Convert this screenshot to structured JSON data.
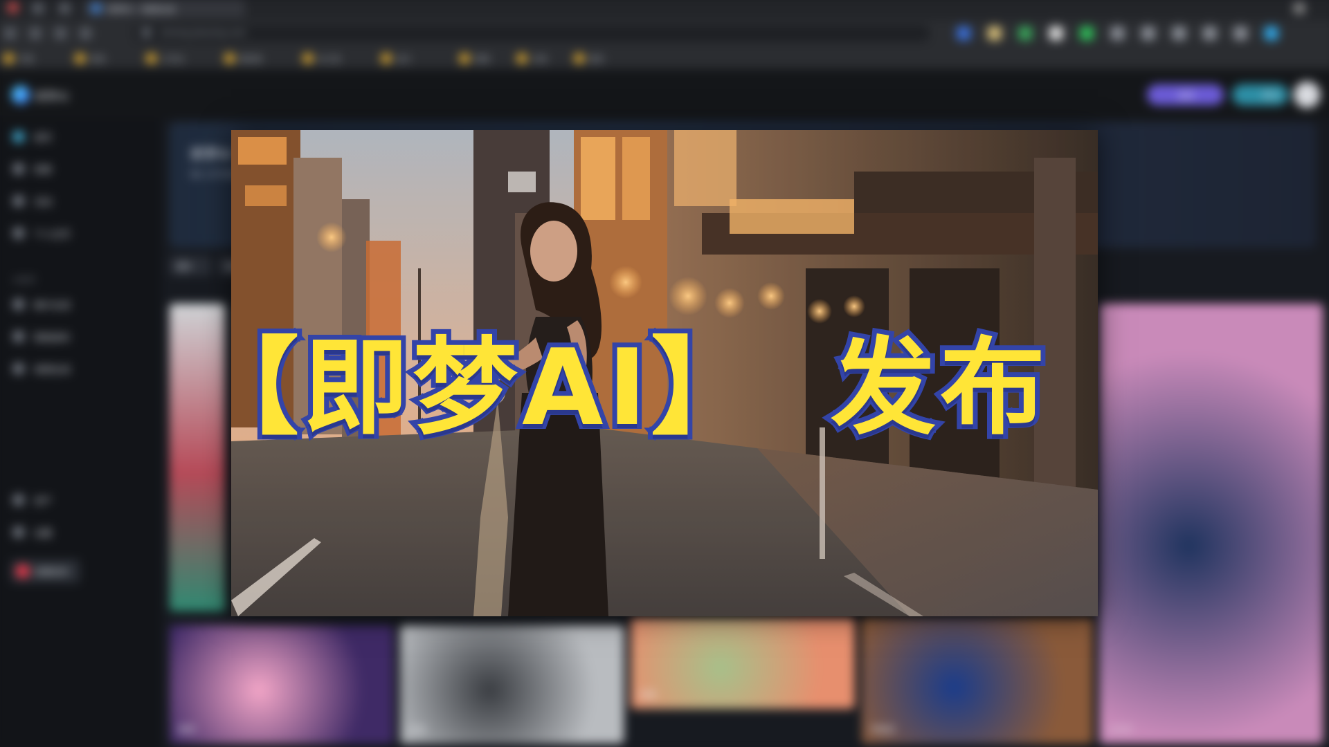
{
  "browser": {
    "tabs": [
      {
        "label": "即梦AI - 视频生成"
      }
    ],
    "address": "jimeng.jianying.com",
    "bookmarks": [
      {
        "label": "书签"
      },
      {
        "label": "常用"
      },
      {
        "label": "工作台"
      },
      {
        "label": "素材库"
      },
      {
        "label": "AI工具"
      },
      {
        "label": "设计"
      },
      {
        "label": "视频"
      },
      {
        "label": "文档"
      },
      {
        "label": "更多"
      }
    ],
    "extension_colors": [
      "#3a6fd8",
      "#d9c07a",
      "#39a55a",
      "#e0e0e0",
      "#2fbf59",
      "#8a8e96",
      "#8a8e96",
      "#8a8e96",
      "#8a8e96",
      "#8a8e96",
      "#31a7e6"
    ]
  },
  "site": {
    "brand": "即梦AI",
    "header_buttons": [
      {
        "label": "会员",
        "color": "#6b5bd6"
      },
      {
        "label": "积分",
        "color": "#2d8fa6"
      }
    ],
    "sidebar": {
      "items": [
        {
          "label": "首页"
        },
        {
          "label": "探索"
        },
        {
          "label": "活动"
        },
        {
          "label": "个人主页"
        }
      ],
      "section": "AI创作",
      "create_items": [
        {
          "label": "图片生成"
        },
        {
          "label": "智能画布"
        },
        {
          "label": "视频生成"
        }
      ],
      "badge": "故事创作",
      "bottom_items": [
        {
          "label": "资产"
        },
        {
          "label": "设置"
        }
      ]
    },
    "hero": {
      "title": "即梦AI 视频生成",
      "subtitle": "输入文字或图片，生成精彩视频"
    },
    "filters": [
      {
        "label": "图片"
      },
      {
        "label": "视频"
      }
    ],
    "gallery": [
      {
        "label": "星球",
        "colors": [
          "#f3a6c7",
          "#3f2a66"
        ]
      },
      {
        "label": "花海",
        "colors": [
          "#3a3d42",
          "#b9bcc0"
        ]
      },
      {
        "label": "田园",
        "colors": [
          "#a7c08a",
          "#e78f6e"
        ]
      },
      {
        "label": "宇航员",
        "colors": [
          "#1b3c8a",
          "#8a5a3a"
        ]
      },
      {
        "label": "小王子",
        "colors": [
          "#20345f",
          "#c98ab9"
        ]
      }
    ]
  },
  "overlay": {
    "part1": "【即梦AI】",
    "part2": "发布",
    "text_color": "#ffe537",
    "outline_color": "#3344a8"
  },
  "video_frame": {
    "subject": "woman-standing-on-street-at-sunset"
  }
}
